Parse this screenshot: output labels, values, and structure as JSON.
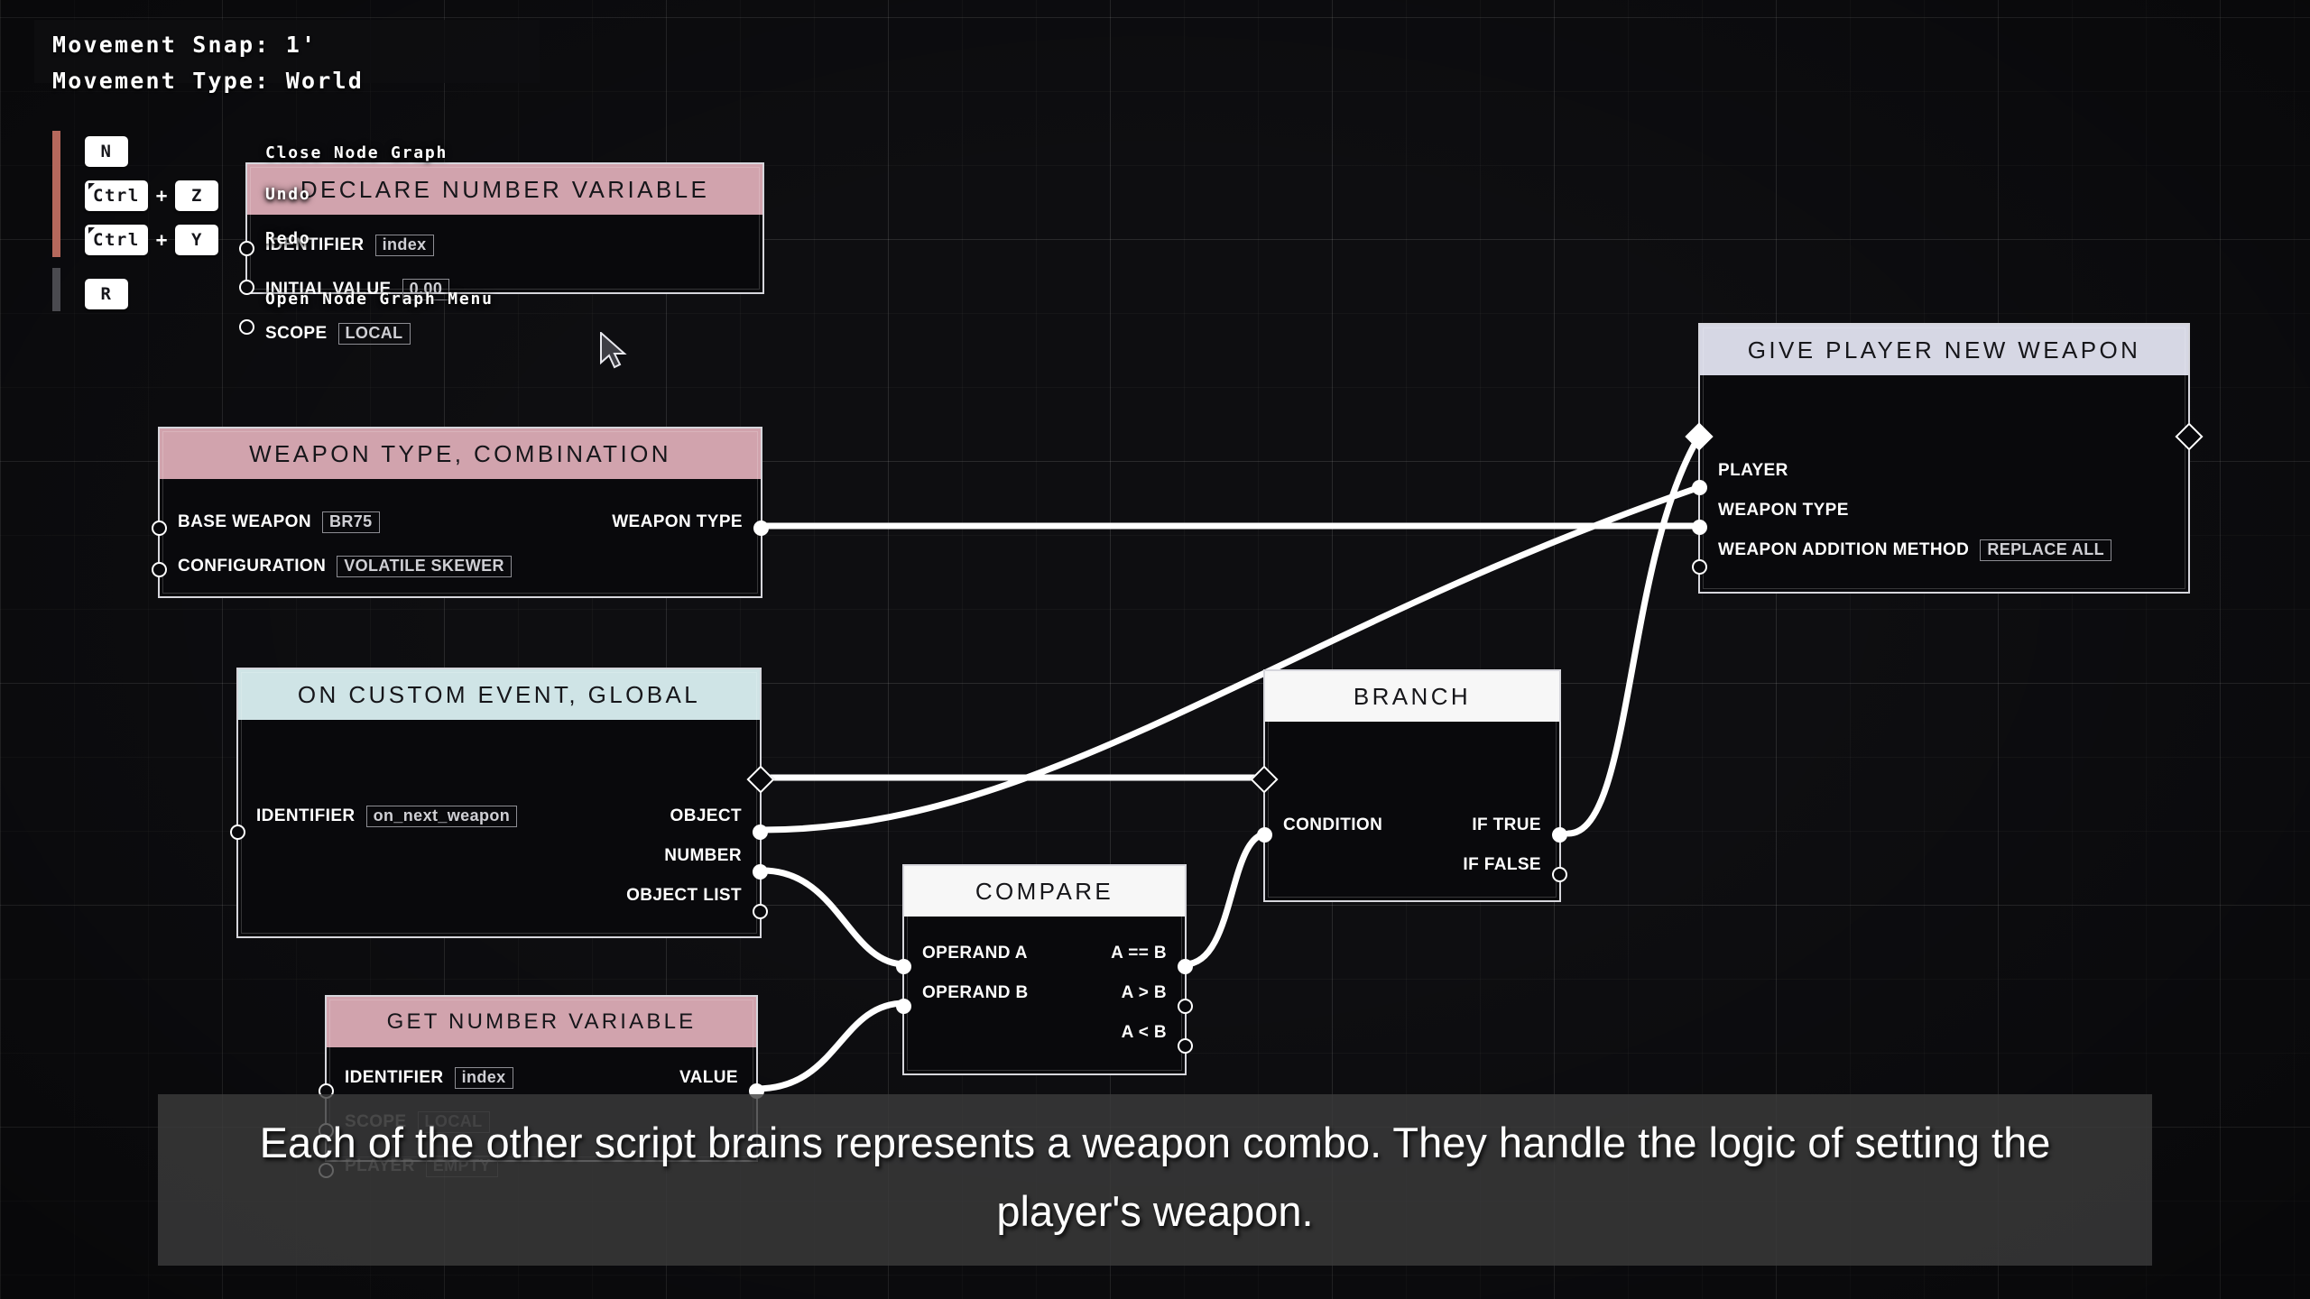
{
  "hud": {
    "movement_snap": "Movement Snap: 1'",
    "movement_type": "Movement Type: World"
  },
  "shortcuts": [
    {
      "keys": [
        "N"
      ],
      "label": "Close Node Graph"
    },
    {
      "keys": [
        "Ctrl",
        "Z"
      ],
      "label": "Undo"
    },
    {
      "keys": [
        "Ctrl",
        "Y"
      ],
      "label": "Redo"
    },
    {
      "keys": [
        "R"
      ],
      "label": "Open Node Graph Menu"
    }
  ],
  "colors": {
    "header_pink": "#d1a3ad",
    "header_pink_dim": "#b88c96",
    "header_cyan": "#cfe4e6",
    "header_white": "#f7f7f7",
    "header_lavender": "#d6d7e4",
    "accent_rust": "#b5685c",
    "wire": "#ffffff",
    "canvas": "#0e0e11"
  },
  "nodes": [
    {
      "id": "declare-number-variable",
      "title": "DECLARE NUMBER VARIABLE",
      "header_color": "#d1a3ad",
      "inputs": [
        {
          "label": "IDENTIFIER",
          "value": "index"
        },
        {
          "label": "INITIAL VALUE",
          "value": "0.00"
        },
        {
          "label": "SCOPE",
          "value": "LOCAL"
        }
      ],
      "outputs": []
    },
    {
      "id": "weapon-type-combination",
      "title": "WEAPON TYPE, COMBINATION",
      "header_color": "#d1a3ad",
      "inputs": [
        {
          "label": "BASE WEAPON",
          "value": "BR75"
        },
        {
          "label": "CONFIGURATION",
          "value": "VOLATILE SKEWER"
        }
      ],
      "outputs": [
        {
          "label": "WEAPON TYPE",
          "value": ""
        }
      ]
    },
    {
      "id": "on-custom-event-global",
      "title": "ON CUSTOM EVENT, GLOBAL",
      "header_color": "#cfe4e6",
      "inputs": [
        {
          "label": "IDENTIFIER",
          "value": "on_next_weapon"
        }
      ],
      "outputs": [
        {
          "label": "OBJECT",
          "value": ""
        },
        {
          "label": "NUMBER",
          "value": ""
        },
        {
          "label": "OBJECT LIST",
          "value": ""
        }
      ]
    },
    {
      "id": "get-number-variable",
      "title": "GET NUMBER VARIABLE",
      "header_color": "#d1a3ad",
      "inputs": [
        {
          "label": "IDENTIFIER",
          "value": "index"
        },
        {
          "label": "SCOPE",
          "value": "LOCAL"
        },
        {
          "label": "PLAYER",
          "value": "EMPTY"
        }
      ],
      "outputs": [
        {
          "label": "VALUE",
          "value": ""
        }
      ]
    },
    {
      "id": "compare",
      "title": "COMPARE",
      "header_color": "#f7f7f7",
      "inputs": [
        {
          "label": "OPERAND A",
          "value": ""
        },
        {
          "label": "OPERAND B",
          "value": ""
        }
      ],
      "outputs": [
        {
          "label": "A == B",
          "value": ""
        },
        {
          "label": "A > B",
          "value": ""
        },
        {
          "label": "A < B",
          "value": ""
        }
      ]
    },
    {
      "id": "branch",
      "title": "BRANCH",
      "header_color": "#f7f7f7",
      "inputs": [
        {
          "label": "CONDITION",
          "value": ""
        }
      ],
      "outputs": [
        {
          "label": "IF TRUE",
          "value": ""
        },
        {
          "label": "IF FALSE",
          "value": ""
        }
      ]
    },
    {
      "id": "give-player-new-weapon",
      "title": "GIVE PLAYER NEW WEAPON",
      "header_color": "#d6d7e4",
      "inputs": [
        {
          "label": "PLAYER",
          "value": ""
        },
        {
          "label": "WEAPON TYPE",
          "value": ""
        },
        {
          "label": "WEAPON ADDITION METHOD",
          "value": "REPLACE ALL"
        }
      ],
      "outputs": []
    }
  ],
  "caption": {
    "text": "Each of the other script brains represents a weapon combo. They handle the logic of setting the player's weapon."
  },
  "cursor": {
    "icon": "mouse-pointer-icon"
  }
}
